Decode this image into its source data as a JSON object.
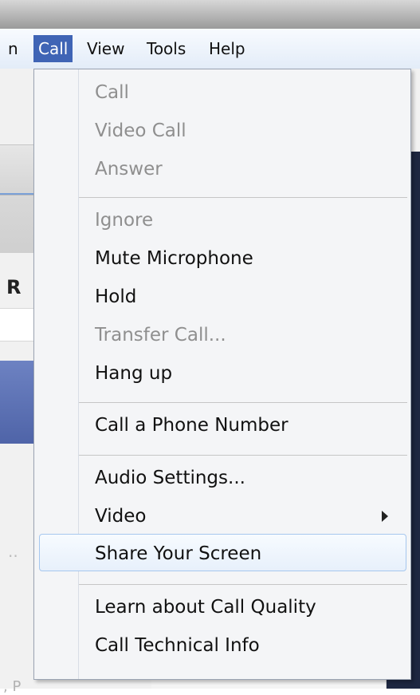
{
  "menubar": {
    "items": [
      {
        "label": "n"
      },
      {
        "label": "Call"
      },
      {
        "label": "View"
      },
      {
        "label": "Tools"
      },
      {
        "label": "Help"
      }
    ]
  },
  "left": {
    "visible_letter": "R",
    "dots": "..",
    "fragment": ", P"
  },
  "menu": {
    "items": [
      {
        "label": "Call"
      },
      {
        "label": "Video Call"
      },
      {
        "label": "Answer"
      },
      {
        "label": "Ignore"
      },
      {
        "label": "Mute Microphone"
      },
      {
        "label": "Hold"
      },
      {
        "label": "Transfer Call..."
      },
      {
        "label": "Hang up"
      },
      {
        "label": "Call a Phone Number"
      },
      {
        "label": "Audio Settings..."
      },
      {
        "label": "Video"
      },
      {
        "label": "Share Your Screen"
      },
      {
        "label": "Learn about Call Quality"
      },
      {
        "label": "Call Technical Info"
      }
    ]
  }
}
